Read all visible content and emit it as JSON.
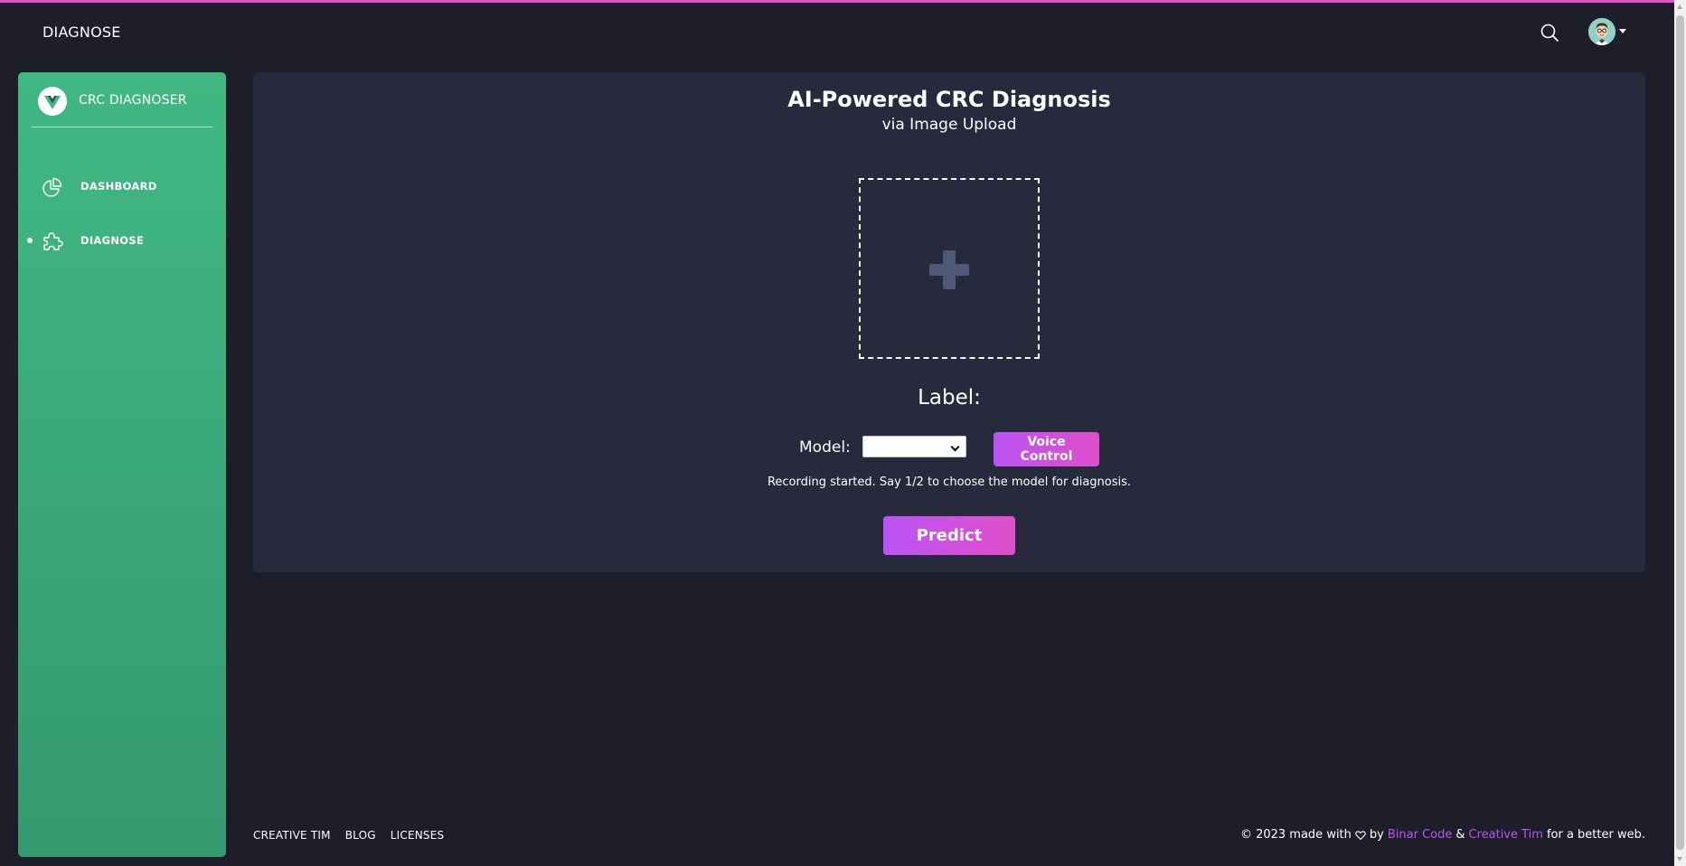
{
  "navbar": {
    "title": "DIAGNOSE",
    "icons": {
      "search": "search-icon",
      "avatar": "user-avatar",
      "caret": "caret-down-icon"
    }
  },
  "sidebar": {
    "brand": {
      "name": "CRC DIAGNOSER",
      "logo": "vue-logo-icon"
    },
    "items": [
      {
        "label": "DASHBOARD",
        "icon": "chart-pie-icon",
        "active": false
      },
      {
        "label": "DIAGNOSE",
        "icon": "puzzle-icon",
        "active": true
      }
    ]
  },
  "main": {
    "title": "AI-Powered CRC Diagnosis",
    "subtitle": "via Image Upload",
    "upload_icon": "plus-icon",
    "label_heading": "Label:",
    "model": {
      "label": "Model:",
      "selected": ""
    },
    "voice_button": "Voice Control",
    "recording_message": "Recording started. Say 1/2 to choose the model for diagnosis.",
    "predict_button": "Predict"
  },
  "footer": {
    "links": [
      "CREATIVE TIM",
      "BLOG",
      "LICENSES"
    ],
    "copyright_prefix": "© 2023 made with",
    "heart_icon": "heart-icon",
    "by": "by",
    "author1": "Binar Code",
    "amp": "&",
    "author2": "Creative Tim",
    "suffix": "for a better web."
  },
  "colors": {
    "background": "#1e1e2b",
    "card": "#27293d",
    "sidebar_start": "#41b883",
    "sidebar_end": "#349a6f",
    "accent_start": "#ba54f5",
    "accent_end": "#e14eca"
  }
}
